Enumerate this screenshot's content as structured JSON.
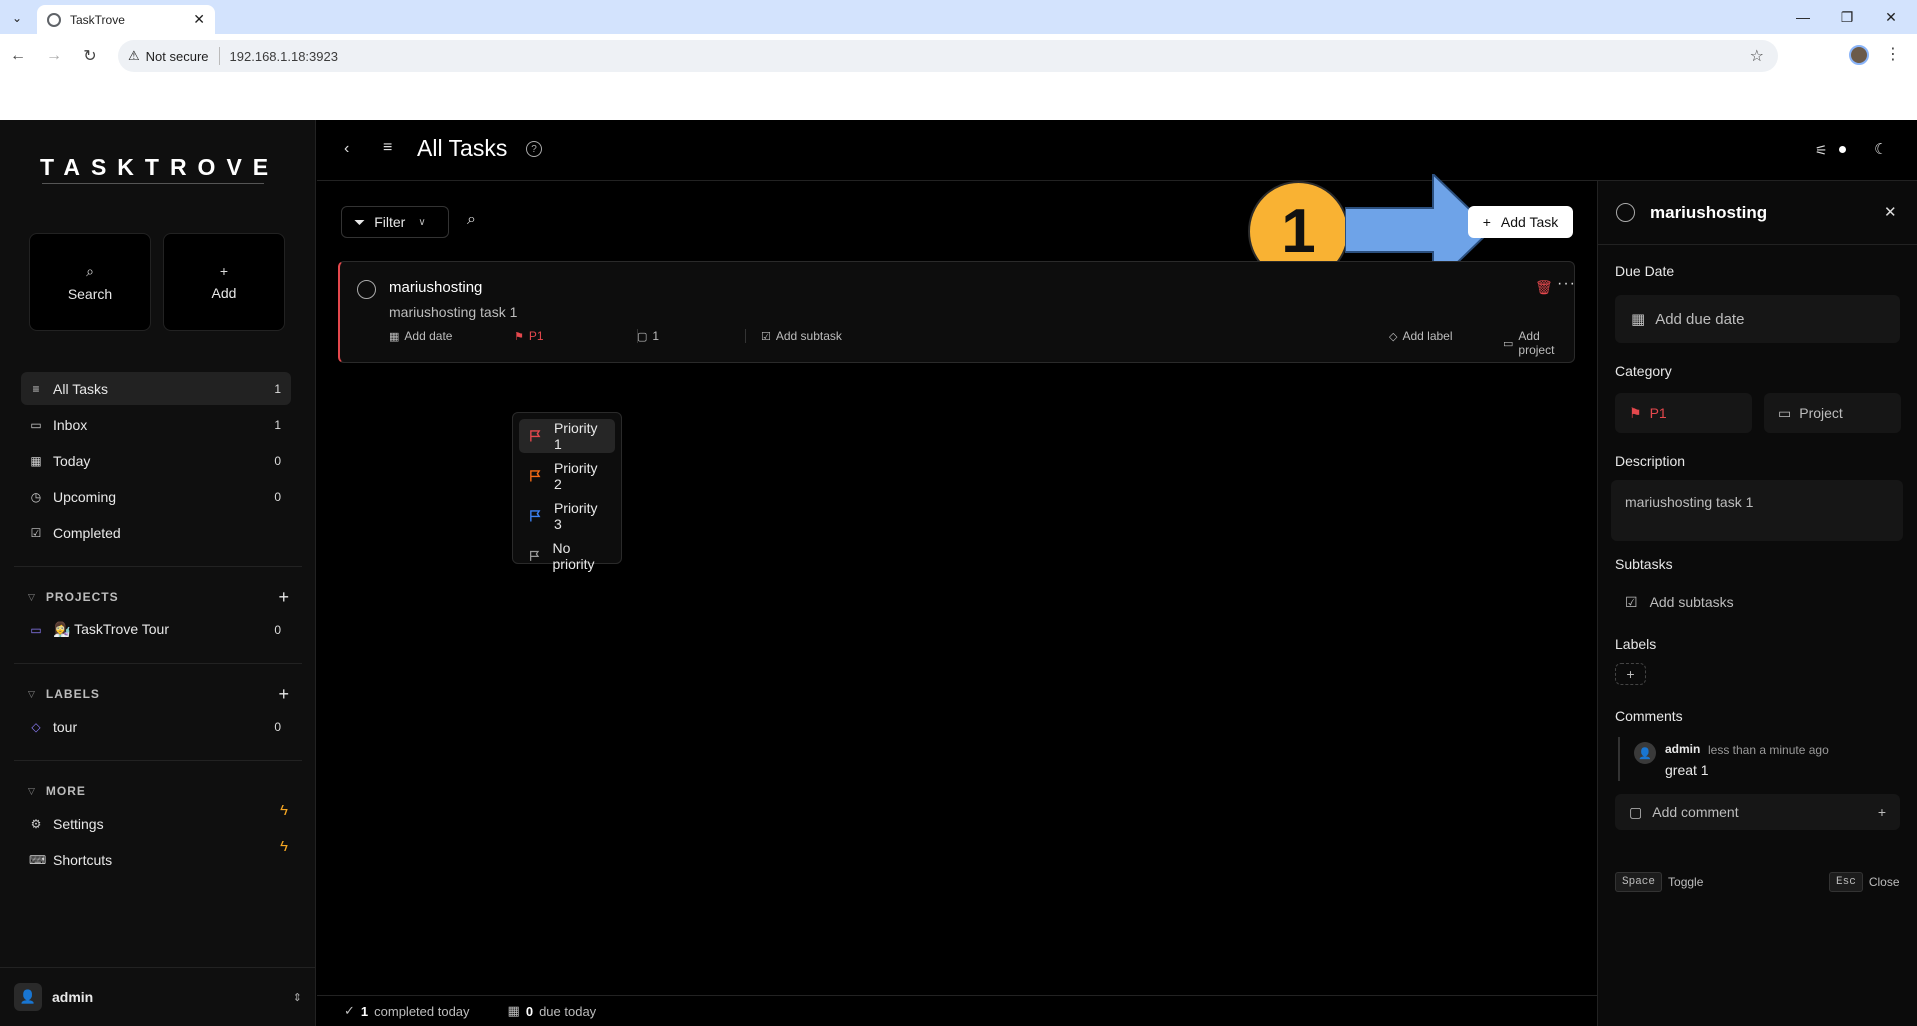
{
  "browser": {
    "tab_title": "TaskTrove",
    "security_label": "Not secure",
    "url": "192.168.1.18:3923"
  },
  "sidebar": {
    "logo": "TASKTROVE",
    "quick_search": "Search",
    "quick_add": "Add",
    "nav": [
      {
        "label": "All Tasks",
        "count": "1"
      },
      {
        "label": "Inbox",
        "count": "1"
      },
      {
        "label": "Today",
        "count": "0"
      },
      {
        "label": "Upcoming",
        "count": "0"
      },
      {
        "label": "Completed",
        "count": ""
      }
    ],
    "projects_heading": "PROJECTS",
    "projects": [
      {
        "label": "👩‍🔬 TaskTrove Tour",
        "count": "0"
      }
    ],
    "labels_heading": "LABELS",
    "labels": [
      {
        "label": "tour",
        "count": "0"
      }
    ],
    "more_heading": "MORE",
    "more": [
      {
        "label": "Settings"
      },
      {
        "label": "Shortcuts"
      }
    ],
    "user": "admin"
  },
  "header": {
    "title": "All Tasks"
  },
  "toolbar": {
    "filter_label": "Filter",
    "add_task_label": "Add Task"
  },
  "annotation": {
    "step": "1"
  },
  "task": {
    "title": "mariushosting",
    "description": "mariushosting task 1",
    "add_date": "Add date",
    "priority": "P1",
    "comments": "1",
    "add_subtask": "Add subtask",
    "add_label": "Add label",
    "add_project": "Add project"
  },
  "priority_menu": {
    "items": [
      {
        "label": "Priority 1",
        "color": "#e5484d"
      },
      {
        "label": "Priority 2",
        "color": "#f76b15"
      },
      {
        "label": "Priority 3",
        "color": "#3b82f6"
      },
      {
        "label": "No priority",
        "color": "#9a9a9a"
      }
    ]
  },
  "footer": {
    "completed_count": "1",
    "completed_label": "completed today",
    "due_count": "0",
    "due_label": "due today"
  },
  "panel": {
    "title": "mariushosting",
    "due_date_heading": "Due Date",
    "due_date_placeholder": "Add due date",
    "category_heading": "Category",
    "priority": "P1",
    "project": "Project",
    "description_heading": "Description",
    "description": "mariushosting task 1",
    "subtasks_heading": "Subtasks",
    "add_subtasks": "Add subtasks",
    "labels_heading": "Labels",
    "comments_heading": "Comments",
    "comment": {
      "author": "admin",
      "time": "less than a minute ago",
      "text": "great 1"
    },
    "add_comment": "Add comment",
    "shortcut_space": "Space",
    "shortcut_space_action": "Toggle",
    "shortcut_esc": "Esc",
    "shortcut_esc_action": "Close"
  },
  "colors": {
    "priority_red": "#e5484d",
    "accent_orange": "#f9b233",
    "arrow_blue": "#6ea3e8",
    "bolt_yellow": "#f5a623"
  }
}
